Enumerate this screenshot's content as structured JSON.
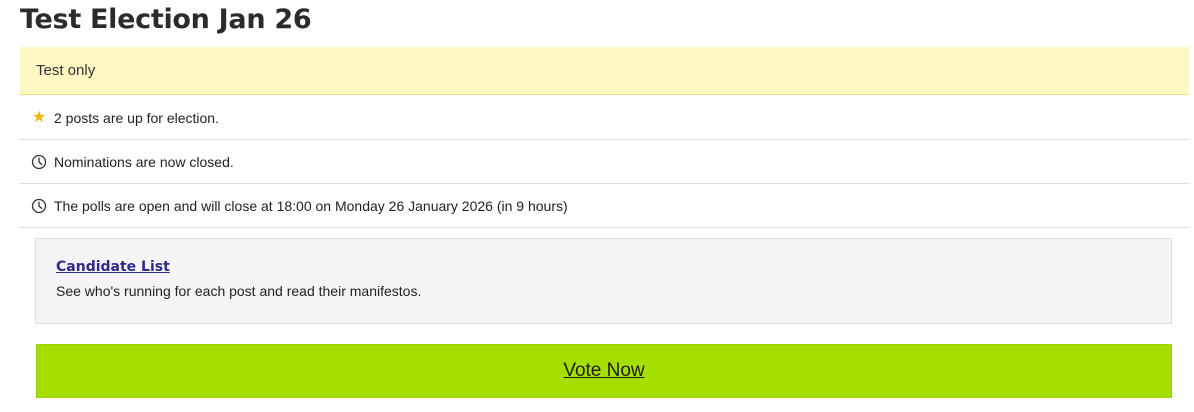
{
  "page": {
    "title": "Test Election Jan 26"
  },
  "notice": {
    "text": "Test only"
  },
  "info": [
    {
      "icon": "star-icon",
      "text": "2 posts are up for election."
    },
    {
      "icon": "clock-icon",
      "text": "Nominations are now closed."
    },
    {
      "icon": "clock-icon",
      "text": "The polls are open and will close at 18:00 on Monday 26 January 2026 (in 9 hours)"
    }
  ],
  "candidates": {
    "link_label": "Candidate List",
    "description": "See who's running for each post and read their manifestos."
  },
  "vote": {
    "label": "Vote Now"
  },
  "colors": {
    "notice_bg": "#fff7c2",
    "star": "#f2b705",
    "link": "#2d2b8a",
    "vote_bg": "#a5df00"
  }
}
